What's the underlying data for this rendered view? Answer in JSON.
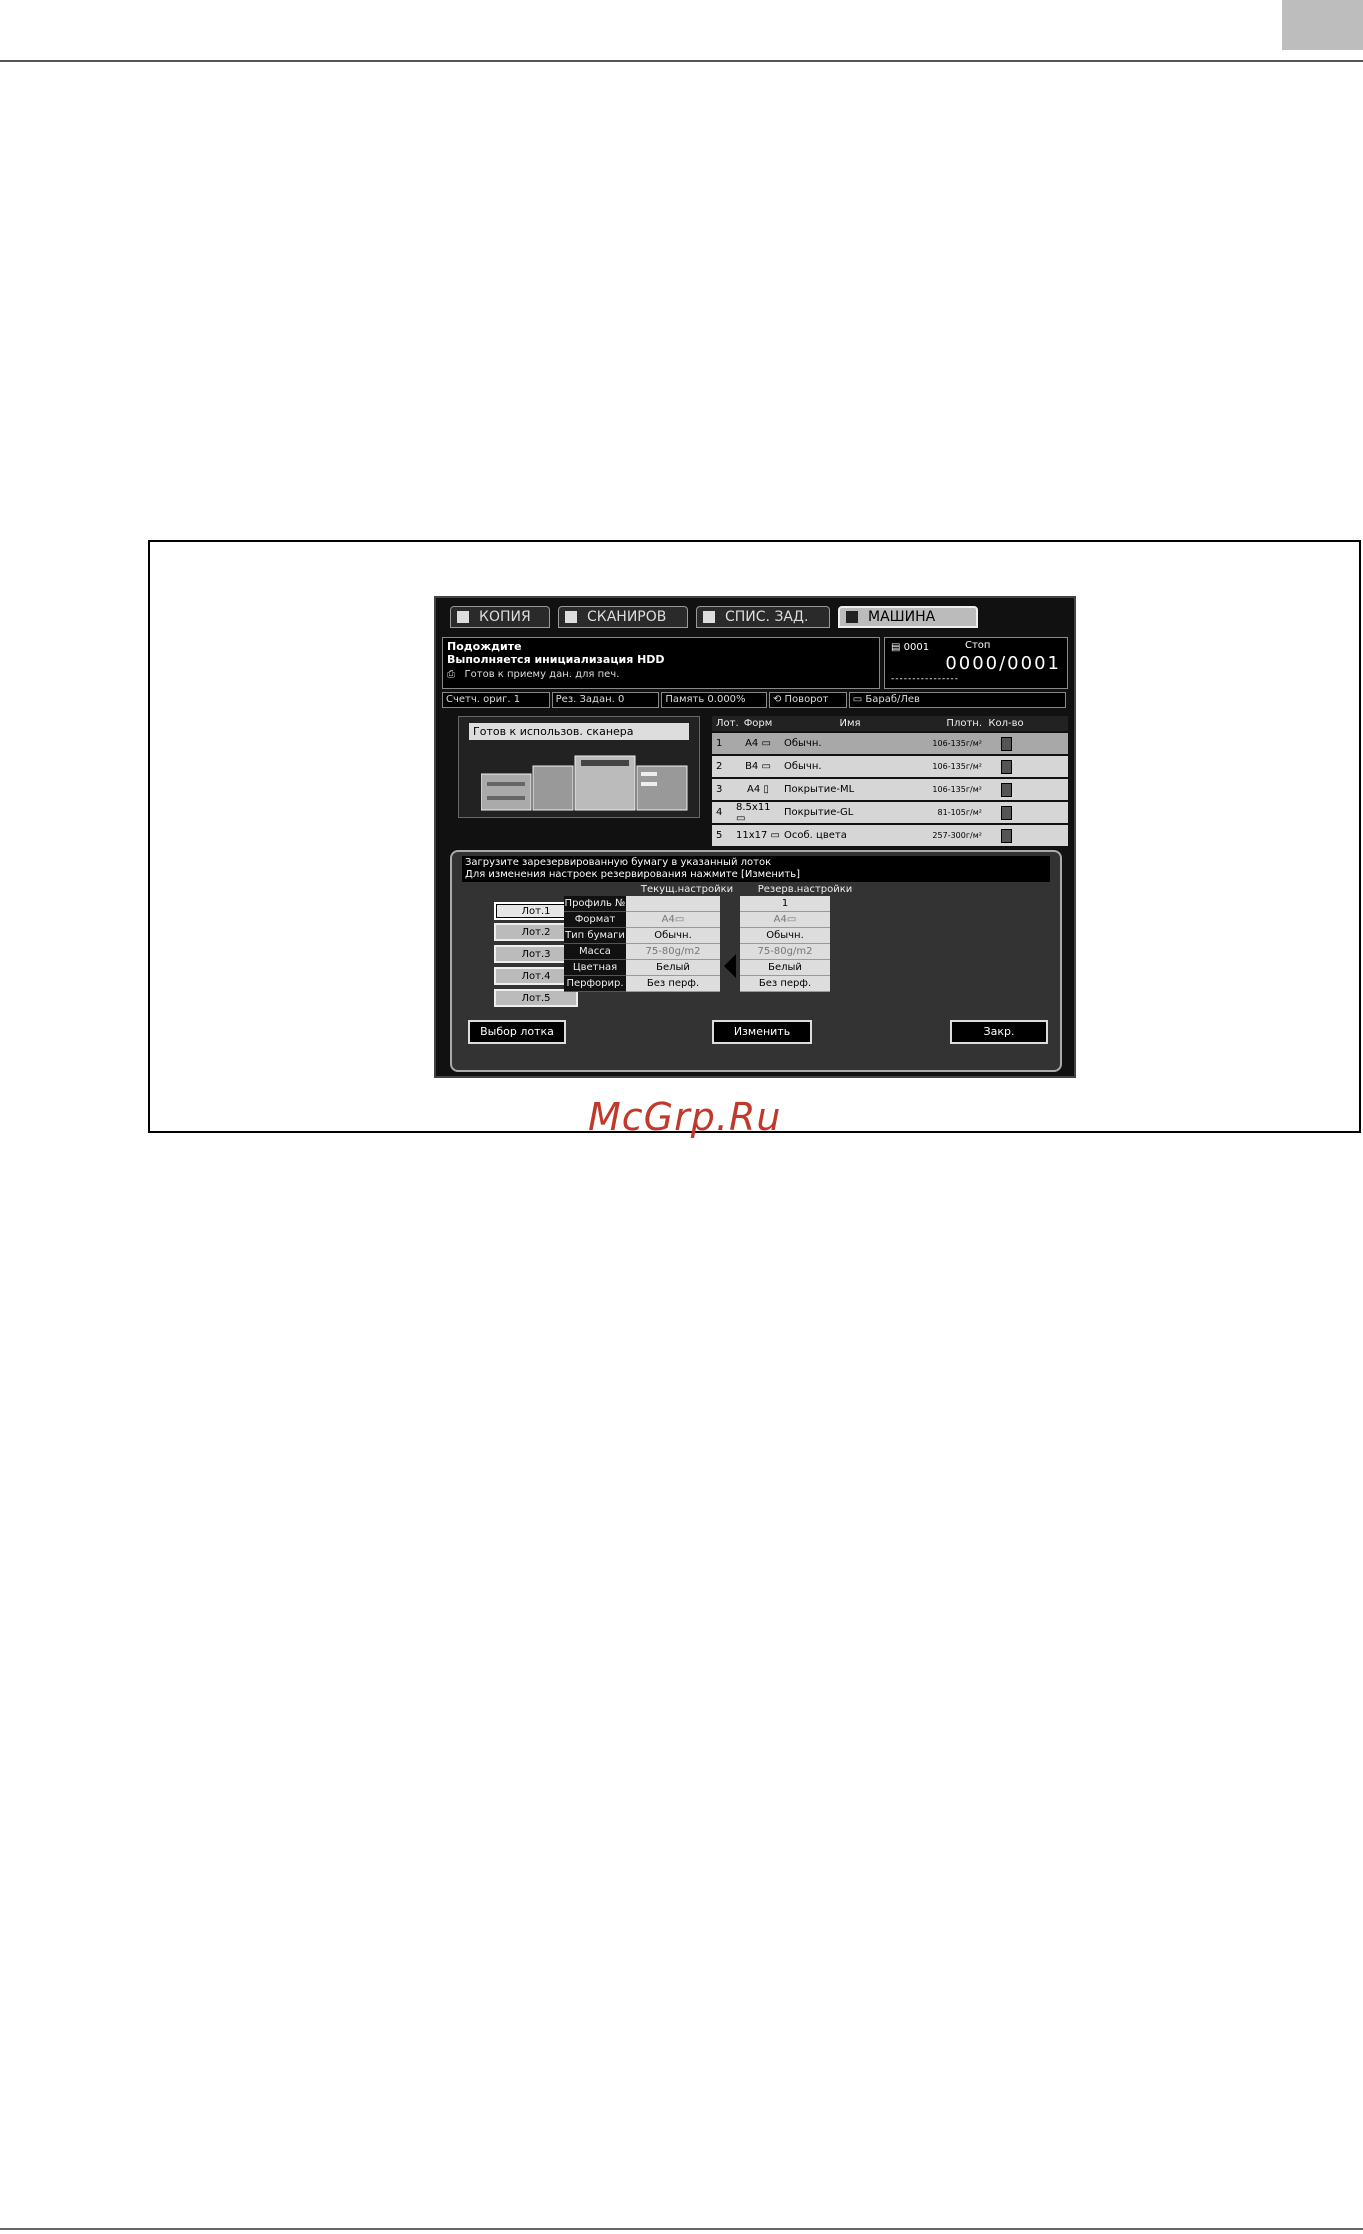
{
  "tabs": [
    {
      "label": "КОПИЯ",
      "icon": "copy-icon"
    },
    {
      "label": "СКАНИРОВ",
      "icon": "scan-icon"
    },
    {
      "label": "СПИС. ЗАД.",
      "icon": "job-list-icon"
    },
    {
      "label": "МАШИНА",
      "icon": "machine-icon"
    }
  ],
  "status": {
    "line1": "Подождите",
    "line2": "Выполняется инициализация HDD",
    "line3": "Готов к приему дан. для печ."
  },
  "counter": {
    "job": "0001",
    "stop": "Стоп",
    "value": "0000/0001",
    "dashes": "----------------"
  },
  "infobar": {
    "orig_count": "Счетч. ориг.     1",
    "reserve_jobs": "Рез. Задан.     0",
    "memory": "Память     0.000%",
    "rotation": "Поворот",
    "drum": "Бараб/Лев"
  },
  "scanner": {
    "status": "Готов к использов. сканера"
  },
  "tray_table": {
    "headers": [
      "Лот.",
      "Форм",
      "Имя",
      "Плотн.",
      "Кол-во"
    ],
    "rows": [
      {
        "lot": "1",
        "format": "A4 ▭",
        "name": "Обычн.",
        "density": "106-135г/м²"
      },
      {
        "lot": "2",
        "format": "B4 ▭",
        "name": "Обычн.",
        "density": "106-135г/м²"
      },
      {
        "lot": "3",
        "format": "A4 ▯",
        "name": "Покрытие-ML",
        "density": "106-135г/м²"
      },
      {
        "lot": "4",
        "format": "8.5x11 ▭",
        "name": "Покрытие-GL",
        "density": "81-105г/м²"
      },
      {
        "lot": "5",
        "format": "11x17 ▭",
        "name": "Особ. цвета",
        "density": "257-300г/м²"
      }
    ]
  },
  "popup": {
    "message_line1": "Загрузите зарезервированную бумагу в указанный лоток",
    "message_line2": "Для изменения настроек резервирования нажмите [Изменить]",
    "current_title": "Текущ.настройки",
    "reserve_title": "Резерв.настройки",
    "lot_buttons": [
      "Лот.1",
      "Лот.2",
      "Лот.3",
      "Лот.4",
      "Лот.5"
    ],
    "setting_labels": [
      "Профиль №",
      "Формат",
      "Тип бумаги",
      "Масса",
      "Цветная",
      "Перфорир."
    ],
    "current_values": [
      "",
      "A4▭",
      "Обычн.",
      "75-80g/m2",
      "Белый",
      "Без перф."
    ],
    "reserve_values": [
      "1",
      "A4▭",
      "Обычн.",
      "75-80g/m2",
      "Белый",
      "Без перф."
    ],
    "tray_select_button": "Выбор лотка",
    "change_button": "Изменить",
    "close_button": "Закр."
  },
  "watermark": "McGrp.Ru"
}
